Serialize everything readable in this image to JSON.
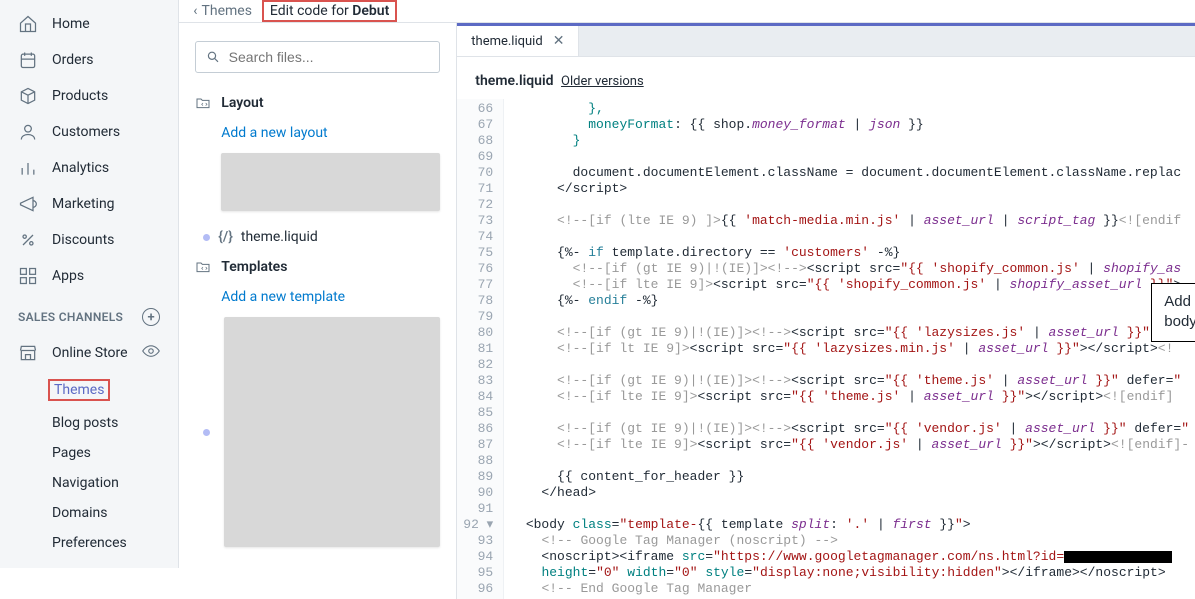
{
  "sidebar": {
    "items": [
      {
        "label": "Home"
      },
      {
        "label": "Orders"
      },
      {
        "label": "Products"
      },
      {
        "label": "Customers"
      },
      {
        "label": "Analytics"
      },
      {
        "label": "Marketing"
      },
      {
        "label": "Discounts"
      },
      {
        "label": "Apps"
      }
    ],
    "sectionHeader": "SALES CHANNELS",
    "channel": "Online Store",
    "sub": [
      {
        "label": "Themes",
        "active": true
      },
      {
        "label": "Blog posts"
      },
      {
        "label": "Pages"
      },
      {
        "label": "Navigation"
      },
      {
        "label": "Domains"
      },
      {
        "label": "Preferences"
      }
    ]
  },
  "topbar": {
    "back": "Themes",
    "titlePrefix": "Edit code for ",
    "titleName": "Debut"
  },
  "filecol": {
    "searchPlaceholder": "Search files...",
    "groups": [
      {
        "title": "Layout",
        "addLabel": "Add a new layout",
        "file": "theme.liquid"
      },
      {
        "title": "Templates",
        "addLabel": "Add a new template"
      }
    ]
  },
  "editor": {
    "tab": "theme.liquid",
    "fileTitle": "theme.liquid",
    "olderVersions": "Older versions",
    "startLine": 66,
    "lines": [
      {
        "n": 66,
        "h": "          <span class='c-b'>},</span>"
      },
      {
        "n": 67,
        "h": "          <span class='c-b'>moneyFormat</span>: {{ shop.<span class='c-d ital'>money_format</span> | <span class='c-d ital'>json</span> }}"
      },
      {
        "n": 68,
        "h": "        <span class='c-b'>}</span>"
      },
      {
        "n": 69,
        "h": ""
      },
      {
        "n": 70,
        "h": "        document.documentElement.className = document.documentElement.className.replac"
      },
      {
        "n": 71,
        "h": "      &lt;/script&gt;"
      },
      {
        "n": 72,
        "h": ""
      },
      {
        "n": 73,
        "h": "      <span class='c-a'>&lt;!--[if (lte IE 9) ]&gt;</span>{{ <span class='c-f'>'match-media.min.js'</span> | <span class='c-d ital'>asset_url</span> | <span class='c-d ital'>script_tag</span> }}<span class='c-a'>&lt;![endif</span>"
      },
      {
        "n": 74,
        "h": ""
      },
      {
        "n": 75,
        "h": "      {%- <span class='c-e'>if</span> template.directory == <span class='c-f'>'customers'</span> -%}"
      },
      {
        "n": 76,
        "h": "        <span class='c-a'>&lt;!--[if (gt IE 9)|!(IE)]&gt;&lt;!--&gt;</span>&lt;script src=<span class='c-f'>\"{{ 'shopify_common.js'</span> | <span class='c-d ital'>shopify_as</span>"
      },
      {
        "n": 77,
        "h": "        <span class='c-a'>&lt;!--[if lte IE 9]&gt;</span>&lt;script src=<span class='c-f'>\"{{ 'shopify_common.js'</span> | <span class='c-d ital'>shopify_asset_url</span> <span class='c-f'>}}\"</span>&gt;"
      },
      {
        "n": 78,
        "h": "      {%- <span class='c-e'>endif</span> -%}"
      },
      {
        "n": 79,
        "h": ""
      },
      {
        "n": 80,
        "h": "      <span class='c-a'>&lt;!--[if (gt IE 9)|!(IE)]&gt;&lt;!--&gt;</span>&lt;script src=<span class='c-f'>\"{{ 'lazysizes.js'</span> | <span class='c-d ital'>asset_url</span> <span class='c-f'>}}\"</span> asy"
      },
      {
        "n": 81,
        "h": "      <span class='c-a'>&lt;!--[if lt IE 9]&gt;</span>&lt;script src=<span class='c-f'>\"{{ 'lazysizes.min.js'</span> | <span class='c-d ital'>asset_url</span> <span class='c-f'>}}\"</span>&gt;&lt;/script&gt;<span class='c-a'>&lt;!</span>"
      },
      {
        "n": 82,
        "h": ""
      },
      {
        "n": 83,
        "h": "      <span class='c-a'>&lt;!--[if (gt IE 9)|!(IE)]&gt;&lt;!--&gt;</span>&lt;script src=<span class='c-f'>\"{{ 'theme.js'</span> | <span class='c-d ital'>asset_url</span> <span class='c-f'>}}\"</span> defer=<span class='c-f'>\"</span>"
      },
      {
        "n": 84,
        "h": "      <span class='c-a'>&lt;!--[if lte IE 9]&gt;</span>&lt;script src=<span class='c-f'>\"{{ 'theme.js'</span> | <span class='c-d ital'>asset_url</span> <span class='c-f'>}}\"</span>&gt;&lt;/script&gt;<span class='c-a'>&lt;![endif]</span>"
      },
      {
        "n": 85,
        "h": ""
      },
      {
        "n": 86,
        "h": "      <span class='c-a'>&lt;!--[if (gt IE 9)|!(IE)]&gt;&lt;!--&gt;</span>&lt;script src=<span class='c-f'>\"{{ 'vendor.js'</span> | <span class='c-d ital'>asset_url</span> <span class='c-f'>}}\"</span> defer=<span class='c-f'>\"</span>"
      },
      {
        "n": 87,
        "h": "      <span class='c-a'>&lt;!--[if lte IE 9]&gt;</span>&lt;script src=<span class='c-f'>\"{{ 'vendor.js'</span> | <span class='c-d ital'>asset_url</span> <span class='c-f'>}}\"</span>&gt;&lt;/script&gt;<span class='c-a'>&lt;![endif]-</span>"
      },
      {
        "n": 88,
        "h": ""
      },
      {
        "n": 89,
        "h": "      {{ content_for_header }}"
      },
      {
        "n": 90,
        "h": "    &lt;/head&gt;"
      },
      {
        "n": 91,
        "h": ""
      },
      {
        "n": 92,
        "h": "  &lt;body <span class='c-b'>class</span>=<span class='c-f'>\"template-</span>{{ template <span class='c-d ital'>split</span>: <span class='c-f'>'.'</span> | <span class='c-d ital'>first</span> }}<span class='c-f'>\"</span>&gt;",
        "arrow": true
      },
      {
        "n": 93,
        "h": "    <span class='c-a'>&lt;!-- Google Tag Manager (noscript) --&gt;</span>"
      },
      {
        "n": 94,
        "h": "    &lt;noscript&gt;&lt;iframe <span class='c-b'>src</span>=<span class='c-f'>\"https://www.googletagmanager.com/ns.html?id=</span><span class='blackout'></span>"
      },
      {
        "n": 95,
        "h": "    <span class='c-b'>height</span>=<span class='c-f'>\"0\"</span> <span class='c-b'>width</span>=<span class='c-f'>\"0\"</span> <span class='c-b'>style</span>=<span class='c-f'>\"display:none;visibility:hidden\"</span>&gt;&lt;/iframe&gt;&lt;/noscript&gt;"
      },
      {
        "n": 96,
        "h": "    <span class='c-a'>&lt;!-- End Google Tag Manager</span>"
      }
    ]
  },
  "callout": "Add your GTM body tag just after the opening body tag in theme.liquid"
}
